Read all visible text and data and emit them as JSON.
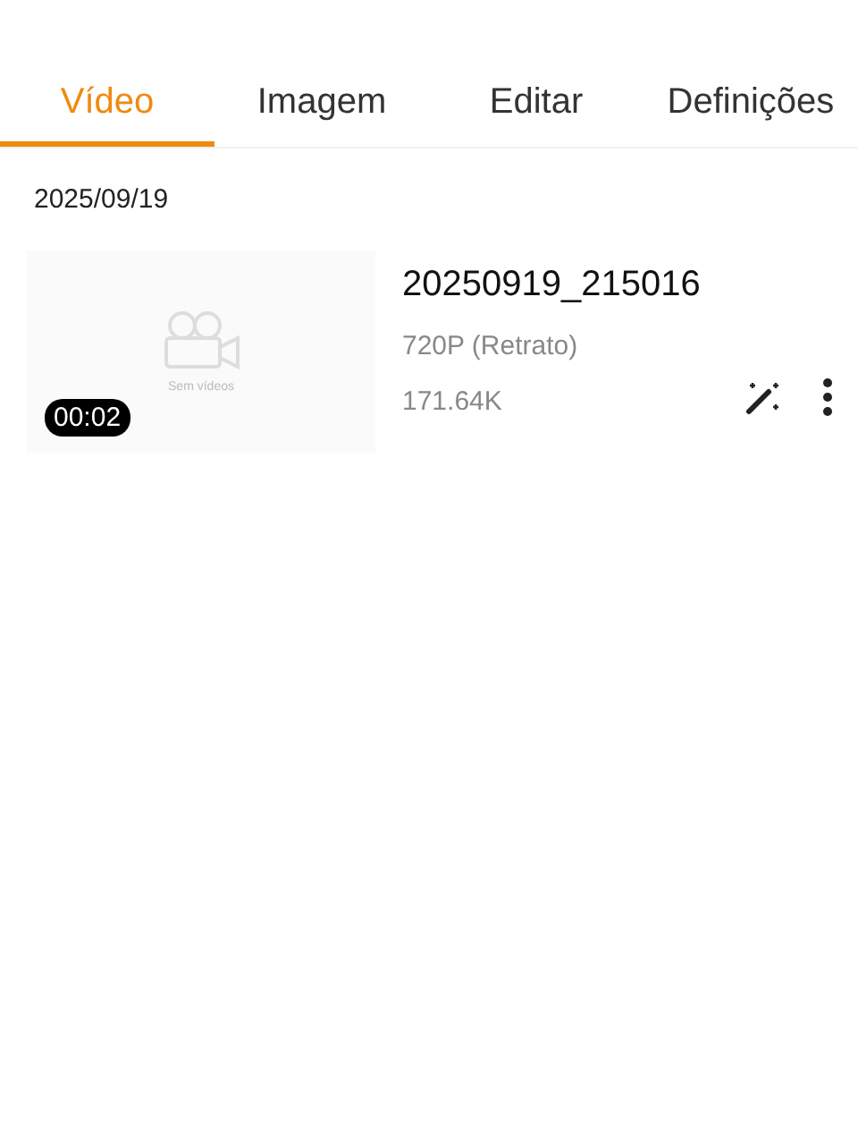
{
  "tabs": [
    {
      "label": "Vídeo",
      "selected": true
    },
    {
      "label": "Imagem",
      "selected": false
    },
    {
      "label": "Editar",
      "selected": false
    },
    {
      "label": "Definições",
      "selected": false
    }
  ],
  "groups": [
    {
      "date": "2025/09/19",
      "videos": [
        {
          "name": "20250919_215016",
          "thumbnail_caption": "Sem vídeos",
          "duration": "00:02",
          "resolution": "720P (Retrato)",
          "size": "171.64K"
        }
      ]
    }
  ]
}
